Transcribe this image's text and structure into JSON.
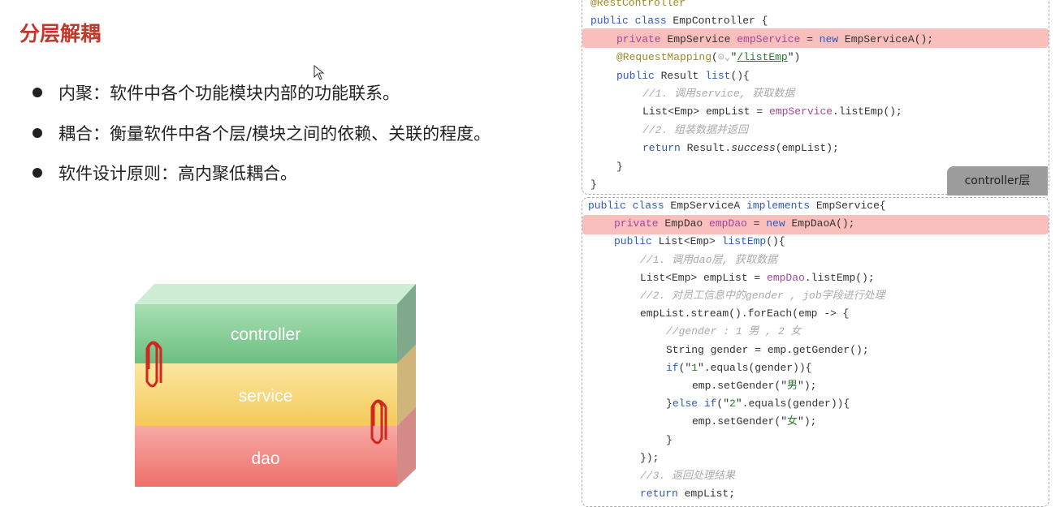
{
  "slide": {
    "title": "分层解耦",
    "bullets": [
      "内聚：软件中各个功能模块内部的功能联系。",
      "耦合：衡量软件中各个层/模块之间的依赖、关联的程度。",
      "软件设计原则：高内聚低耦合。"
    ]
  },
  "diagram": {
    "layers": [
      {
        "label": "controller",
        "color": "#7dc98f"
      },
      {
        "label": "service",
        "color": "#f7d36a"
      },
      {
        "label": "dao",
        "color": "#f2807c"
      }
    ],
    "clip_color": "#d0281f"
  },
  "controller_code": {
    "tag": "controller层",
    "highlight_line": 2,
    "lines": [
      {
        "indent": 0,
        "tokens": [
          [
            "@RestController",
            "an"
          ]
        ]
      },
      {
        "indent": 0,
        "tokens": [
          [
            "public class ",
            "kw"
          ],
          [
            "EmpController {",
            "id"
          ]
        ]
      },
      {
        "indent": 1,
        "tokens": [
          [
            "private ",
            "fld"
          ],
          [
            "EmpService ",
            "id"
          ],
          [
            "empService",
            "fld"
          ],
          [
            " = ",
            "id"
          ],
          [
            "new ",
            "kw"
          ],
          [
            "EmpServiceA();",
            "id"
          ]
        ]
      },
      {
        "indent": 1,
        "tokens": [
          [
            "@RequestMapping",
            "an"
          ],
          [
            "(",
            "id"
          ],
          [
            "⊙⌄",
            "cm"
          ],
          [
            "\"",
            "id"
          ],
          [
            "/listEmp",
            "url"
          ],
          [
            "\")",
            "id"
          ]
        ]
      },
      {
        "indent": 1,
        "tokens": [
          [
            "public ",
            "kw"
          ],
          [
            "Result ",
            "id"
          ],
          [
            "list",
            "kw"
          ],
          [
            "(){",
            "id"
          ]
        ]
      },
      {
        "indent": 2,
        "tokens": [
          [
            "//1. 调用service, 获取数据",
            "cm"
          ]
        ]
      },
      {
        "indent": 2,
        "tokens": [
          [
            "List<Emp> empList = ",
            "id"
          ],
          [
            "empService",
            "fld"
          ],
          [
            ".listEmp();",
            "id"
          ]
        ]
      },
      {
        "indent": 2,
        "tokens": [
          [
            "//2. 组装数据并返回",
            "cm"
          ]
        ]
      },
      {
        "indent": 2,
        "tokens": [
          [
            "return ",
            "kw"
          ],
          [
            "Result.",
            "id"
          ],
          [
            "success",
            "it"
          ],
          [
            "(empList);",
            "id"
          ]
        ]
      },
      {
        "indent": 1,
        "tokens": [
          [
            "}",
            "id"
          ]
        ]
      },
      {
        "indent": 0,
        "tokens": [
          [
            "}",
            "id"
          ]
        ]
      }
    ]
  },
  "service_code": {
    "highlight_line": 1,
    "lines": [
      {
        "indent": 0,
        "tokens": [
          [
            "public class ",
            "kw"
          ],
          [
            "EmpServiceA ",
            "id"
          ],
          [
            "implements ",
            "kw"
          ],
          [
            "EmpService{",
            "id"
          ]
        ]
      },
      {
        "indent": 1,
        "tokens": [
          [
            "private ",
            "fld"
          ],
          [
            "EmpDao ",
            "id"
          ],
          [
            "empDao",
            "fld"
          ],
          [
            " = ",
            "id"
          ],
          [
            "new ",
            "kw"
          ],
          [
            "EmpDaoA();",
            "id"
          ]
        ]
      },
      {
        "indent": 1,
        "tokens": [
          [
            "public ",
            "kw"
          ],
          [
            "List<Emp> ",
            "id"
          ],
          [
            "listEmp",
            "kw"
          ],
          [
            "(){",
            "id"
          ]
        ]
      },
      {
        "indent": 2,
        "tokens": [
          [
            "//1. 调用dao层, 获取数据",
            "cm"
          ]
        ]
      },
      {
        "indent": 2,
        "tokens": [
          [
            "List<Emp> empList = ",
            "id"
          ],
          [
            "empDao",
            "fld"
          ],
          [
            ".listEmp();",
            "id"
          ]
        ]
      },
      {
        "indent": 2,
        "tokens": [
          [
            "//2. 对员工信息中的gender , job字段进行处理",
            "cm"
          ]
        ]
      },
      {
        "indent": 2,
        "tokens": [
          [
            "empList.stream().forEach(emp -> {",
            "id"
          ]
        ]
      },
      {
        "indent": 3,
        "tokens": [
          [
            "//gender : 1 男 , 2 女",
            "cm"
          ]
        ]
      },
      {
        "indent": 3,
        "tokens": [
          [
            "String gender = emp.getGender();",
            "id"
          ]
        ]
      },
      {
        "indent": 3,
        "tokens": [
          [
            "if",
            "kw"
          ],
          [
            "(\"",
            "id"
          ],
          [
            "1",
            "str"
          ],
          [
            "\".equals(gender)){",
            "id"
          ]
        ]
      },
      {
        "indent": 4,
        "tokens": [
          [
            "emp.setGender(\"",
            "id"
          ],
          [
            "男",
            "str"
          ],
          [
            "\");",
            "id"
          ]
        ]
      },
      {
        "indent": 3,
        "tokens": [
          [
            "}",
            "id"
          ],
          [
            "else if",
            "kw"
          ],
          [
            "(\"",
            "id"
          ],
          [
            "2",
            "str"
          ],
          [
            "\".equals(gender)){",
            "id"
          ]
        ]
      },
      {
        "indent": 4,
        "tokens": [
          [
            "emp.setGender(\"",
            "id"
          ],
          [
            "女",
            "str"
          ],
          [
            "\");",
            "id"
          ]
        ]
      },
      {
        "indent": 3,
        "tokens": [
          [
            "}",
            "id"
          ]
        ]
      },
      {
        "indent": 2,
        "tokens": [
          [
            "});",
            "id"
          ]
        ]
      },
      {
        "indent": 2,
        "tokens": [
          [
            "//3. 返回处理结果",
            "cm"
          ]
        ]
      },
      {
        "indent": 2,
        "tokens": [
          [
            "return ",
            "kw"
          ],
          [
            "empList;",
            "id"
          ]
        ]
      }
    ]
  }
}
